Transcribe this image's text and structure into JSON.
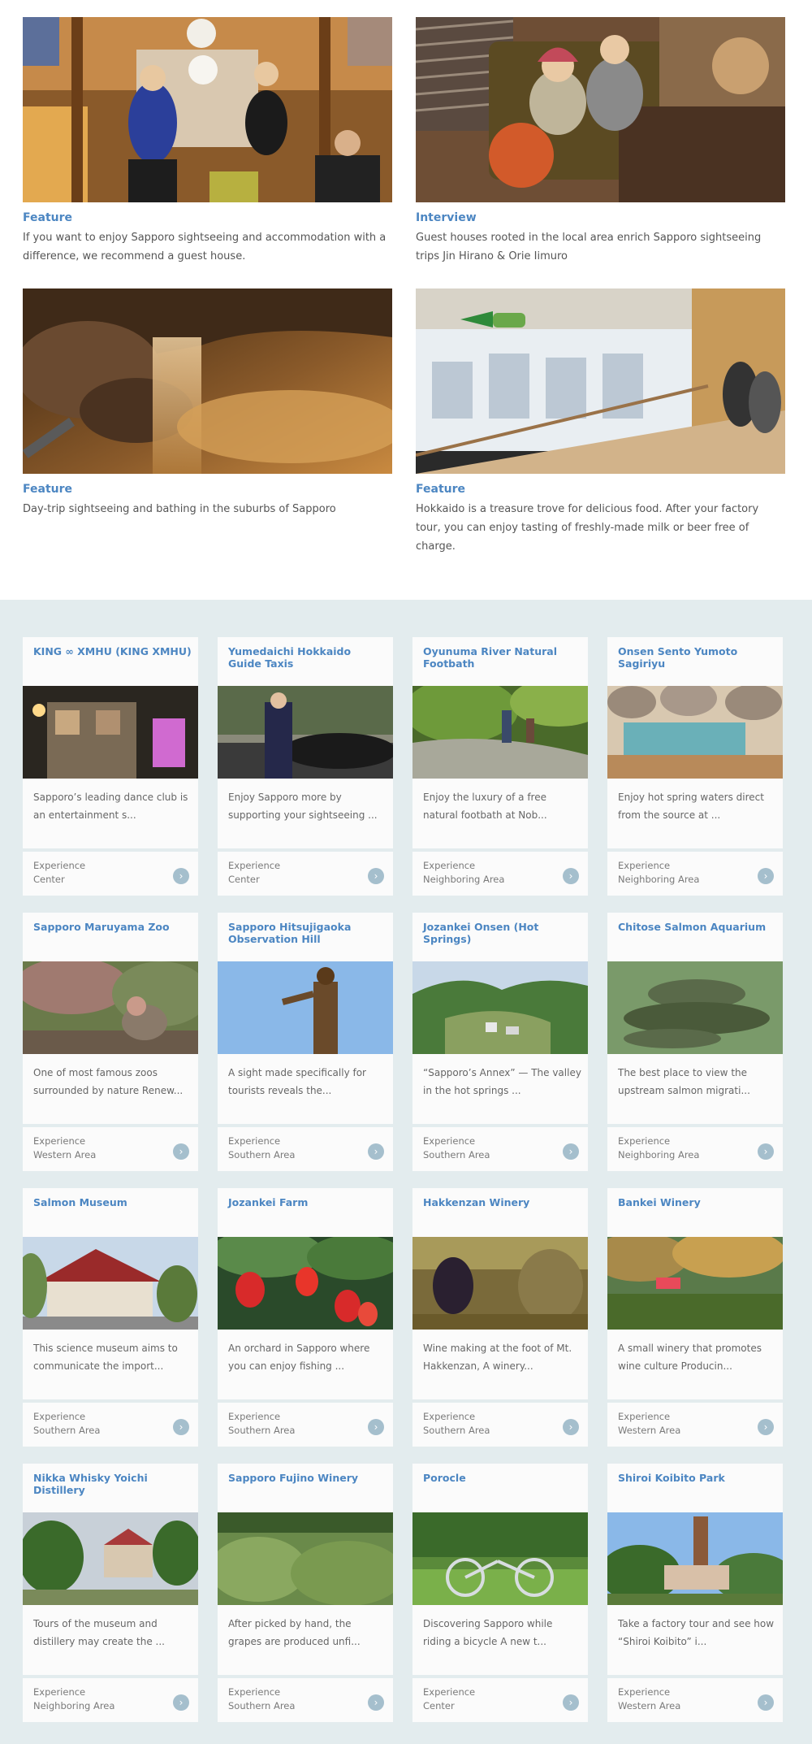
{
  "features": [
    {
      "category": "Feature",
      "text": "If you want to enjoy Sapporo sightseeing and accommodation with a difference, we recommend a guest house."
    },
    {
      "category": "Interview",
      "text": "Guest houses rooted in the local area enrich Sapporo sightseeing trips Jin Hirano & Orie Iimuro"
    },
    {
      "category": "Feature",
      "text": "Day-trip sightseeing and bathing in the suburbs of Sapporo"
    },
    {
      "category": "Feature",
      "text": "Hokkaido is a treasure trove for delicious food. After your factory tour, you can enjoy tasting of freshly-made milk or beer free of charge."
    }
  ],
  "cards": [
    {
      "title": "KING ∞ XMHU (KING XMHU)",
      "desc": "Sapporo’s leading dance club is an entertainment s...",
      "type": "Experience",
      "area": "Center"
    },
    {
      "title": "Yumedaichi Hokkaido Guide Taxis",
      "desc": "Enjoy Sapporo more by supporting your sightseeing ...",
      "type": "Experience",
      "area": "Center"
    },
    {
      "title": "Oyunuma River Natural Footbath",
      "desc": "Enjoy the luxury of a free natural footbath at Nob...",
      "type": "Experience",
      "area": "Neighboring Area"
    },
    {
      "title": "Onsen Sento Yumoto Sagiriyu",
      "desc": "Enjoy hot spring waters direct from the source at ...",
      "type": "Experience",
      "area": "Neighboring Area"
    },
    {
      "title": "Sapporo Maruyama Zoo",
      "desc": "One of most famous zoos surrounded by nature Renew...",
      "type": "Experience",
      "area": "Western Area"
    },
    {
      "title": "Sapporo Hitsujigaoka Observation Hill",
      "desc": "A sight made specifically for tourists reveals the...",
      "type": "Experience",
      "area": "Southern Area"
    },
    {
      "title": "Jozankei Onsen (Hot Springs)",
      "desc": "“Sapporo’s Annex” — The valley in the hot springs ...",
      "type": "Experience",
      "area": "Southern Area"
    },
    {
      "title": "Chitose Salmon Aquarium",
      "desc": "The best place to view the upstream salmon migrati...",
      "type": "Experience",
      "area": "Neighboring Area"
    },
    {
      "title": "Salmon Museum",
      "desc": "This science museum aims to communicate the import...",
      "type": "Experience",
      "area": "Southern Area"
    },
    {
      "title": "Jozankei Farm",
      "desc": "An orchard in Sapporo where you can enjoy fishing ...",
      "type": "Experience",
      "area": "Southern Area"
    },
    {
      "title": "Hakkenzan Winery",
      "desc": "Wine making at the foot of Mt. Hakkenzan, A winery...",
      "type": "Experience",
      "area": "Southern Area"
    },
    {
      "title": "Bankei Winery",
      "desc": "A small winery that promotes wine culture Producin...",
      "type": "Experience",
      "area": "Western Area"
    },
    {
      "title": "Nikka Whisky Yoichi Distillery",
      "desc": "Tours of the museum and distillery may create the ...",
      "type": "Experience",
      "area": "Neighboring Area"
    },
    {
      "title": "Sapporo Fujino Winery",
      "desc": "After picked by hand, the grapes are produced unfi...",
      "type": "Experience",
      "area": "Southern Area"
    },
    {
      "title": "Porocle",
      "desc": "Discovering Sapporo while riding a bicycle A new t...",
      "type": "Experience",
      "area": "Center"
    },
    {
      "title": "Shiroi Koibito Park",
      "desc": "Take a factory tour and see how “Shiroi Koibito” i...",
      "type": "Experience",
      "area": "Western Area"
    }
  ],
  "arrow_glyph": "›"
}
